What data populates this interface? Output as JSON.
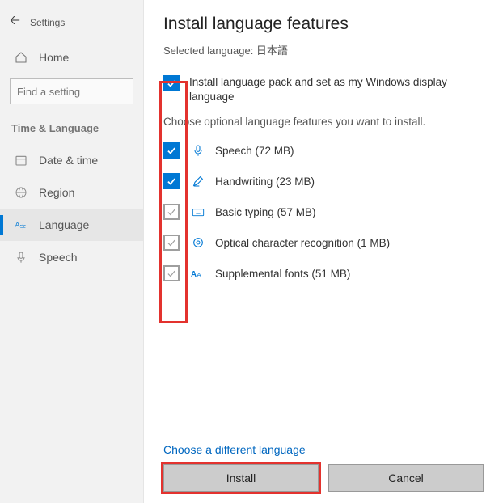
{
  "sidebar": {
    "settings": "Settings",
    "home": "Home",
    "search_placeholder": "Find a setting",
    "category": "Time & Language",
    "items": [
      {
        "label": "Date & time"
      },
      {
        "label": "Region"
      },
      {
        "label": "Language"
      },
      {
        "label": "Speech"
      }
    ]
  },
  "main": {
    "title": "Install language features",
    "subtitle": "Selected language: 日本語",
    "display_label": "Install language pack and set as my Windows display language",
    "optional_desc": "Choose optional language features you want to install.",
    "features": [
      {
        "label": "Speech (72 MB)"
      },
      {
        "label": "Handwriting (23 MB)"
      },
      {
        "label": "Basic typing (57 MB)"
      },
      {
        "label": "Optical character recognition (1 MB)"
      },
      {
        "label": "Supplemental fonts (51 MB)"
      }
    ],
    "link": "Choose a different language",
    "install": "Install",
    "cancel": "Cancel"
  }
}
